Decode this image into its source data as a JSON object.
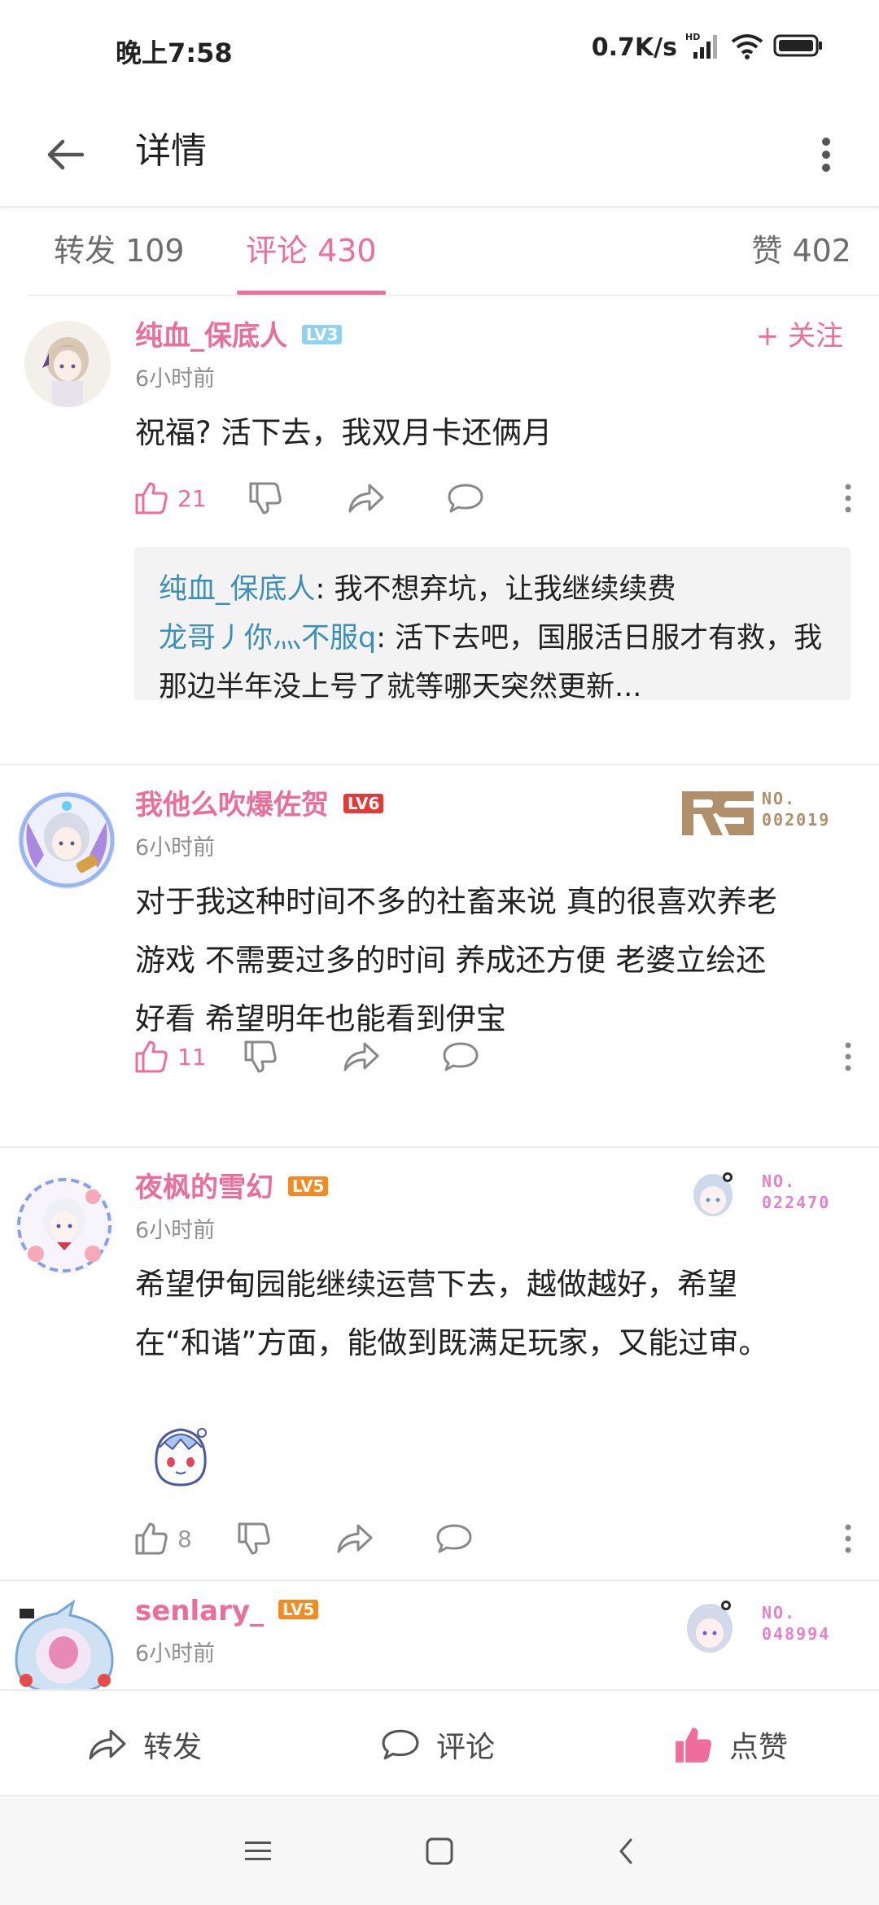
{
  "status_bar": {
    "time": "晚上7:58",
    "net_speed": "0.7K/s",
    "hd_label": "HD"
  },
  "app_bar": {
    "title": "详情",
    "back_icon": "arrow-left-icon",
    "more_icon": "vertical-dots-icon"
  },
  "tabs": {
    "repost": "转发 109",
    "comments": "评论 430",
    "likes": "赞 402",
    "active_color": "#f06c9b"
  },
  "comments": [
    {
      "username": "纯血_保底人",
      "level": "LV3",
      "level_color": "#8fd3f0",
      "time": "6小时前",
      "follow": "+ 关注",
      "content": "祝福? 活下去，我双月卡还俩月",
      "likes": "21",
      "replies": [
        {
          "user": "纯血_保底人",
          "sep": ": ",
          "text": "我不想弃坑，让我继续续费"
        },
        {
          "user": "龙哥丿你灬不服q",
          "sep": ": ",
          "text": "活下去吧，国服活日服才有救，我那边半年没上号了就等哪天突然更新..."
        }
      ]
    },
    {
      "username": "我他么吹爆佐贺",
      "level": "LV6",
      "level_color": "#e53935",
      "time": "6小时前",
      "medal_no": "NO.",
      "medal_num": "002019",
      "medal_color": "#b0906a",
      "content_lines": [
        "对于我这种时间不多的社畜来说 真的很喜欢养老",
        "游戏 不需要过多的时间 养成还方便 老婆立绘还",
        "好看 希望明年也能看到伊宝"
      ],
      "likes": "11"
    },
    {
      "username": "夜枫的雪幻",
      "level": "LV5",
      "level_color": "#f58a1f",
      "time": "6小时前",
      "medal_no": "NO.",
      "medal_num": "022470",
      "medal_color": "#e880c9",
      "content_lines": [
        "希望伊甸园能继续运营下去，越做越好，希望",
        "在“和谐”方面，能做到既满足玩家，又能过审。"
      ],
      "likes": "8"
    },
    {
      "username": "senlary_",
      "level": "LV5",
      "level_color": "#f58a1f",
      "time": "6小时前",
      "medal_no": "NO.",
      "medal_num": "048994",
      "medal_color": "#e880c9"
    }
  ],
  "bottom_bar": {
    "repost": "转发",
    "comment": "评论",
    "like": "点赞"
  }
}
